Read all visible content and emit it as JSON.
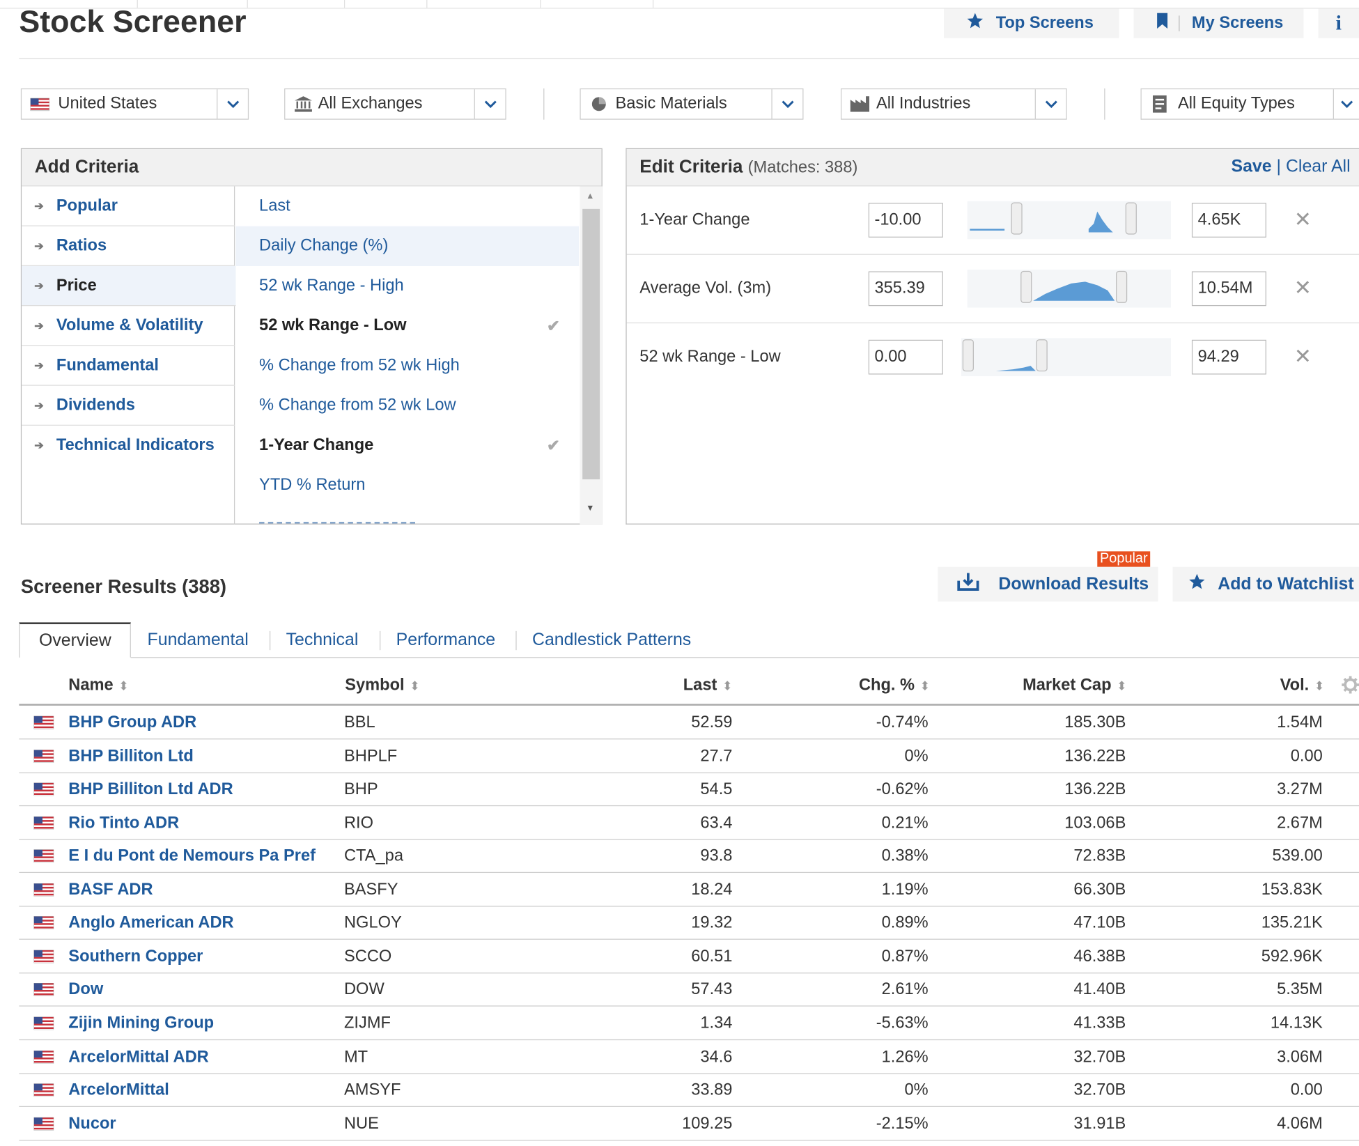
{
  "header": {
    "title": "Stock Screener",
    "top_screens": "Top Screens",
    "my_screens": "My Screens",
    "info": "i"
  },
  "filters": {
    "country": "United States",
    "exchange": "All Exchanges",
    "sector": "Basic Materials",
    "industry": "All Industries",
    "equity_type": "All Equity Types"
  },
  "add_criteria": {
    "title": "Add Criteria",
    "categories": [
      "Popular",
      "Ratios",
      "Price",
      "Volume & Volatility",
      "Fundamental",
      "Dividends",
      "Technical Indicators"
    ],
    "selected_category": "Price",
    "criteria": [
      {
        "label": "Last",
        "checked": false
      },
      {
        "label": "Daily Change (%)",
        "checked": false
      },
      {
        "label": "52 wk Range - High",
        "checked": false
      },
      {
        "label": "52 wk Range - Low",
        "checked": true
      },
      {
        "label": "% Change from 52 wk High",
        "checked": false
      },
      {
        "label": "% Change from 52 wk Low",
        "checked": false
      },
      {
        "label": "1-Year Change",
        "checked": true
      },
      {
        "label": "YTD % Return",
        "checked": false
      }
    ],
    "check_glyph": "✔"
  },
  "edit_criteria": {
    "title": "Edit Criteria",
    "matches": "(Matches: 388)",
    "save": "Save",
    "separator": "|",
    "clear_all": "Clear All",
    "rows": [
      {
        "label": "1-Year Change",
        "min": "-10.00",
        "max": "4.65K",
        "remove": "✕",
        "histogram": "right-peak"
      },
      {
        "label": "Average Vol. (3m)",
        "min": "355.39",
        "max": "10.54M",
        "remove": "✕",
        "histogram": "wide-hump"
      },
      {
        "label": "52 wk Range - Low",
        "min": "0.00",
        "max": "94.29",
        "remove": "✕",
        "histogram": "left-small"
      }
    ]
  },
  "results": {
    "title": "Screener Results (388)",
    "popular_badge": "Popular",
    "download": "Download Results",
    "watchlist": "Add to Watchlist",
    "tabs": [
      "Overview",
      "Fundamental",
      "Technical",
      "Performance",
      "Candlestick Patterns"
    ],
    "active_tab": "Overview",
    "columns": {
      "name": "Name",
      "symbol": "Symbol",
      "last": "Last",
      "chg": "Chg. %",
      "mcap": "Market Cap",
      "vol": "Vol."
    },
    "sort_glyph": "⬍",
    "rows": [
      {
        "name": "BHP Group ADR",
        "symbol": "BBL",
        "last": "52.59",
        "chg": "-0.74%",
        "mcap": "185.30B",
        "vol": "1.54M"
      },
      {
        "name": "BHP Billiton Ltd",
        "symbol": "BHPLF",
        "last": "27.7",
        "chg": "0%",
        "mcap": "136.22B",
        "vol": "0.00"
      },
      {
        "name": "BHP Billiton Ltd ADR",
        "symbol": "BHP",
        "last": "54.5",
        "chg": "-0.62%",
        "mcap": "136.22B",
        "vol": "3.27M"
      },
      {
        "name": "Rio Tinto ADR",
        "symbol": "RIO",
        "last": "63.4",
        "chg": "0.21%",
        "mcap": "103.06B",
        "vol": "2.67M"
      },
      {
        "name": "E I du Pont de Nemours Pa Pref",
        "symbol": "CTA_pa",
        "last": "93.8",
        "chg": "0.38%",
        "mcap": "72.83B",
        "vol": "539.00"
      },
      {
        "name": "BASF ADR",
        "symbol": "BASFY",
        "last": "18.24",
        "chg": "1.19%",
        "mcap": "66.30B",
        "vol": "153.83K"
      },
      {
        "name": "Anglo American ADR",
        "symbol": "NGLOY",
        "last": "19.32",
        "chg": "0.89%",
        "mcap": "47.10B",
        "vol": "135.21K"
      },
      {
        "name": "Southern Copper",
        "symbol": "SCCO",
        "last": "60.51",
        "chg": "0.87%",
        "mcap": "46.38B",
        "vol": "592.96K"
      },
      {
        "name": "Dow",
        "symbol": "DOW",
        "last": "57.43",
        "chg": "2.61%",
        "mcap": "41.40B",
        "vol": "5.35M"
      },
      {
        "name": "Zijin Mining Group",
        "symbol": "ZIJMF",
        "last": "1.34",
        "chg": "-5.63%",
        "mcap": "41.33B",
        "vol": "14.13K"
      },
      {
        "name": "ArcelorMittal ADR",
        "symbol": "MT",
        "last": "34.6",
        "chg": "1.26%",
        "mcap": "32.70B",
        "vol": "3.06M"
      },
      {
        "name": "ArcelorMittal",
        "symbol": "AMSYF",
        "last": "33.89",
        "chg": "0%",
        "mcap": "32.70B",
        "vol": "0.00"
      },
      {
        "name": "Nucor",
        "symbol": "NUE",
        "last": "109.25",
        "chg": "-2.15%",
        "mcap": "31.91B",
        "vol": "4.06M"
      }
    ]
  },
  "colors": {
    "link": "#1f5a9b",
    "histogram": "#5b9bd5",
    "badge": "#e8501f",
    "panel_header": "#f1f1f1"
  }
}
